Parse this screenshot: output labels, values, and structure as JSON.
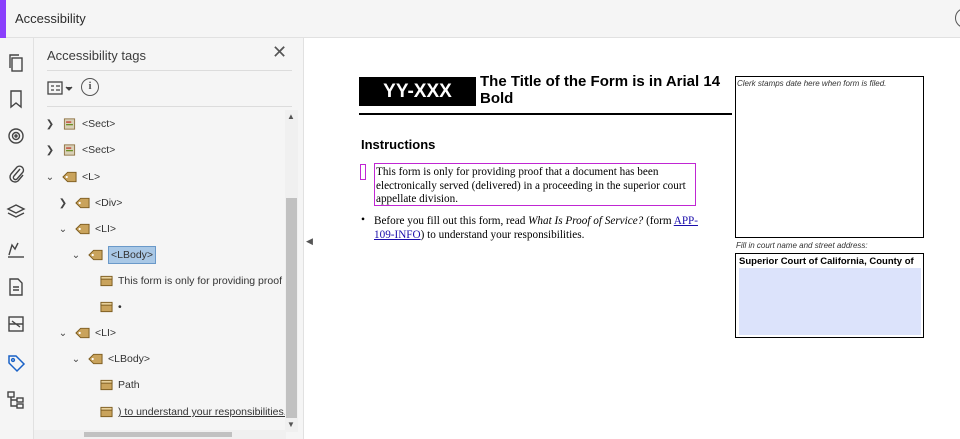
{
  "app": {
    "title": "Accessibility"
  },
  "panel": {
    "title": "Accessibility tags",
    "close": "✕",
    "info": "i",
    "tree": [
      {
        "label": "<Sect>",
        "chev": ">",
        "icon": "section-icon"
      },
      {
        "label": "<Sect>",
        "chev": ">",
        "icon": "section-icon"
      },
      {
        "label": "<L>",
        "chev": "v",
        "icon": "tag-icon"
      },
      {
        "label": "<Div>",
        "chev": ">",
        "icon": "tag-icon"
      },
      {
        "label": "<LI>",
        "chev": "v",
        "icon": "tag-icon"
      },
      {
        "label": "<LBody>",
        "chev": "v",
        "icon": "tag-icon",
        "selected": true
      },
      {
        "label": "This form is only for providing proof th",
        "chev": "",
        "icon": "content-icon"
      },
      {
        "label": "•",
        "chev": "",
        "icon": "content-icon"
      },
      {
        "label": "<LI>",
        "chev": "v",
        "icon": "tag-icon"
      },
      {
        "label": "<LBody>",
        "chev": "v",
        "icon": "tag-icon"
      },
      {
        "label": "Path",
        "chev": "",
        "icon": "content-icon"
      },
      {
        "label": ") to understand your responsibilities.",
        "chev": "",
        "icon": "content-icon",
        "underlined": true
      }
    ]
  },
  "doc": {
    "form_code": "YY-XXX",
    "form_title": "The Title of the Form is in Arial 14 Bold",
    "instructions_heading": "Instructions",
    "bullet1": "This form is only for providing proof that a document has been electronically served (delivered) in a proceeding in the superior court appellate division.",
    "bullet2_pre": "Before you fill out this form, read ",
    "bullet2_em": "What Is Proof of Service?",
    "bullet2_mid": " (form ",
    "bullet2_link": "APP-109-INFO",
    "bullet2_post": ") to understand your responsibilities.",
    "stamp_text": "Clerk stamps date here when form is filed.",
    "court_label": "Fill in court name and street address:",
    "court_title": "Superior Court of California, County of"
  }
}
